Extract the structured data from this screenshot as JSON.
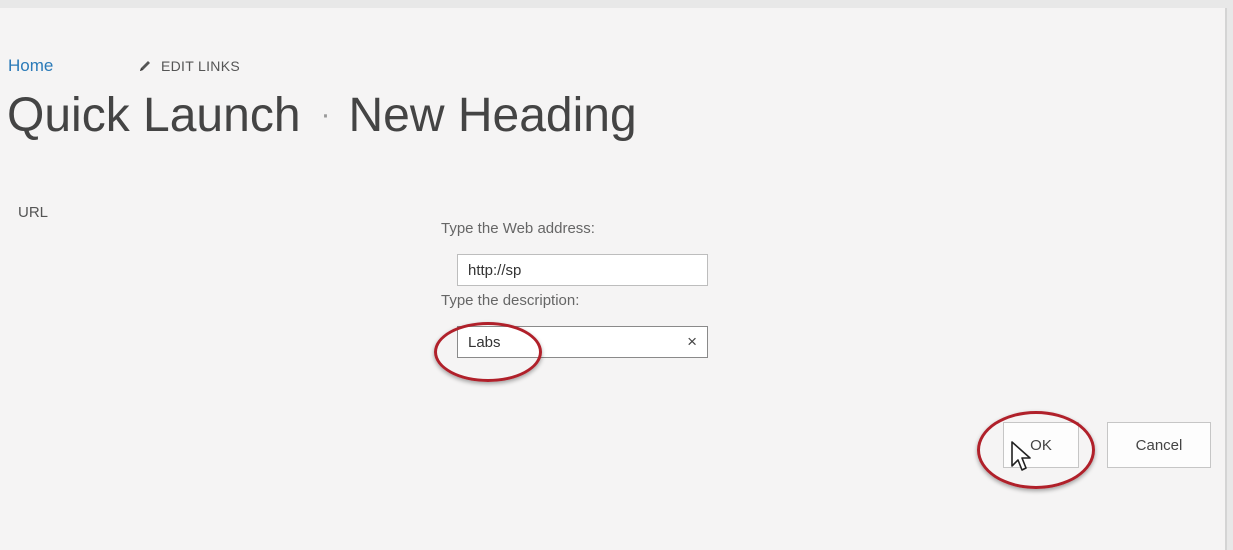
{
  "nav": {
    "home_label": "Home",
    "edit_links_label": "EDIT LINKS",
    "edit_icon": "pencil-icon"
  },
  "page_title": {
    "part1": "Quick Launch",
    "separator": "·",
    "part2": "New Heading"
  },
  "form": {
    "section_label": "URL",
    "web_address_label": "Type the Web address:",
    "web_address_value": "http://sp",
    "description_label": "Type the description:",
    "description_value": "Labs",
    "clear_icon": "close-icon",
    "clear_symbol": "×"
  },
  "buttons": {
    "ok_label": "OK",
    "cancel_label": "Cancel"
  },
  "annotations": {
    "highlight_color": "#b0202a",
    "cursor_icon": "mouse-pointer-icon"
  }
}
